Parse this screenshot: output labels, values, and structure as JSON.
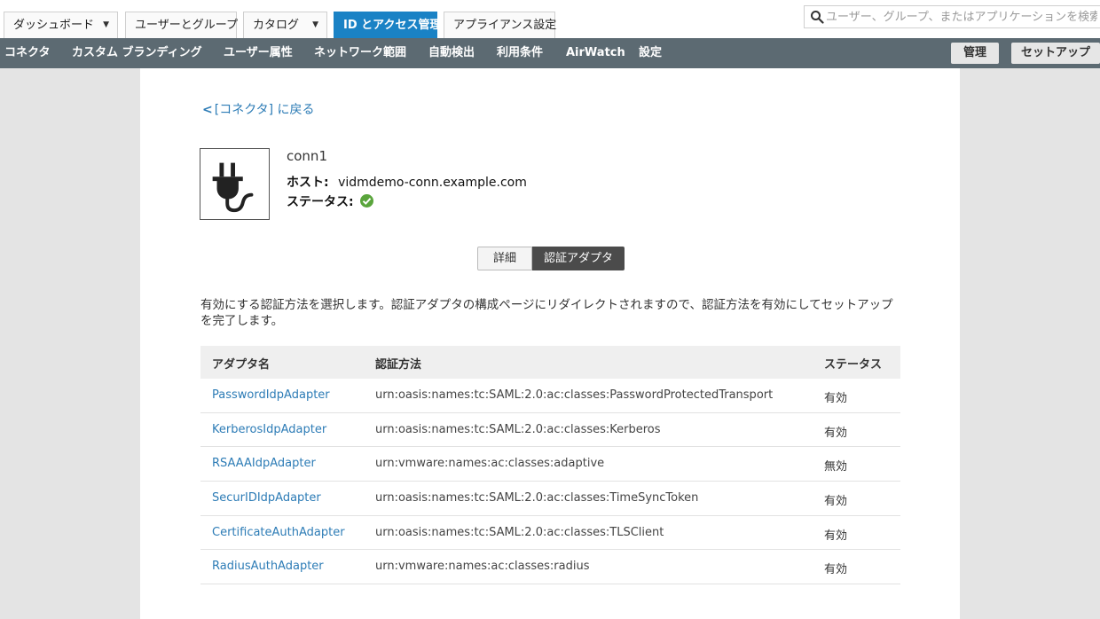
{
  "top_tabs": [
    {
      "label": "ダッシュボード",
      "has_caret": true
    },
    {
      "label": "ユーザーとグループ",
      "has_caret": false
    },
    {
      "label": "カタログ",
      "has_caret": true
    },
    {
      "label": "ID とアクセス管理",
      "has_caret": false,
      "active": true
    },
    {
      "label": "アプライアンス設定",
      "has_caret": false
    }
  ],
  "search": {
    "placeholder": "ユーザー、グループ、またはアプリケーションを検索"
  },
  "subnav": {
    "items": [
      "コネクタ",
      "カスタム ブランディング",
      "ユーザー属性",
      "ネットワーク範囲",
      "自動検出",
      "利用条件",
      "AirWatch",
      "設定"
    ],
    "manage": "管理",
    "setup": "セットアップ"
  },
  "back_link": "[コネクタ] に戻る",
  "connector": {
    "name": "conn1",
    "host_label": "ホスト:",
    "host_value": "vidmdemo-conn.example.com",
    "status_label": "ステータス:"
  },
  "segmented": {
    "details": "詳細",
    "auth_adapters": "認証アダプタ"
  },
  "description": "有効にする認証方法を選択します。認証アダプタの構成ページにリダイレクトされますので、認証方法を有効にしてセットアップを完了します。",
  "table": {
    "headers": {
      "adapter": "アダプタ名",
      "method": "認証方法",
      "status": "ステータス"
    },
    "rows": [
      {
        "adapter": "PasswordIdpAdapter",
        "method": "urn:oasis:names:tc:SAML:2.0:ac:classes:PasswordProtectedTransport",
        "status": "有効"
      },
      {
        "adapter": "KerberosIdpAdapter",
        "method": "urn:oasis:names:tc:SAML:2.0:ac:classes:Kerberos",
        "status": "有効"
      },
      {
        "adapter": "RSAAAIdpAdapter",
        "method": "urn:vmware:names:ac:classes:adaptive",
        "status": "無効"
      },
      {
        "adapter": "SecurIDIdpAdapter",
        "method": "urn:oasis:names:tc:SAML:2.0:ac:classes:TimeSyncToken",
        "status": "有効"
      },
      {
        "adapter": "CertificateAuthAdapter",
        "method": "urn:oasis:names:tc:SAML:2.0:ac:classes:TLSClient",
        "status": "有効"
      },
      {
        "adapter": "RadiusAuthAdapter",
        "method": "urn:vmware:names:ac:classes:radius",
        "status": "有効"
      }
    ]
  },
  "colors": {
    "accent": "#1a82c5",
    "link": "#2d7cb6",
    "subnav": "#5c6a72",
    "ok": "#5aa53c"
  }
}
